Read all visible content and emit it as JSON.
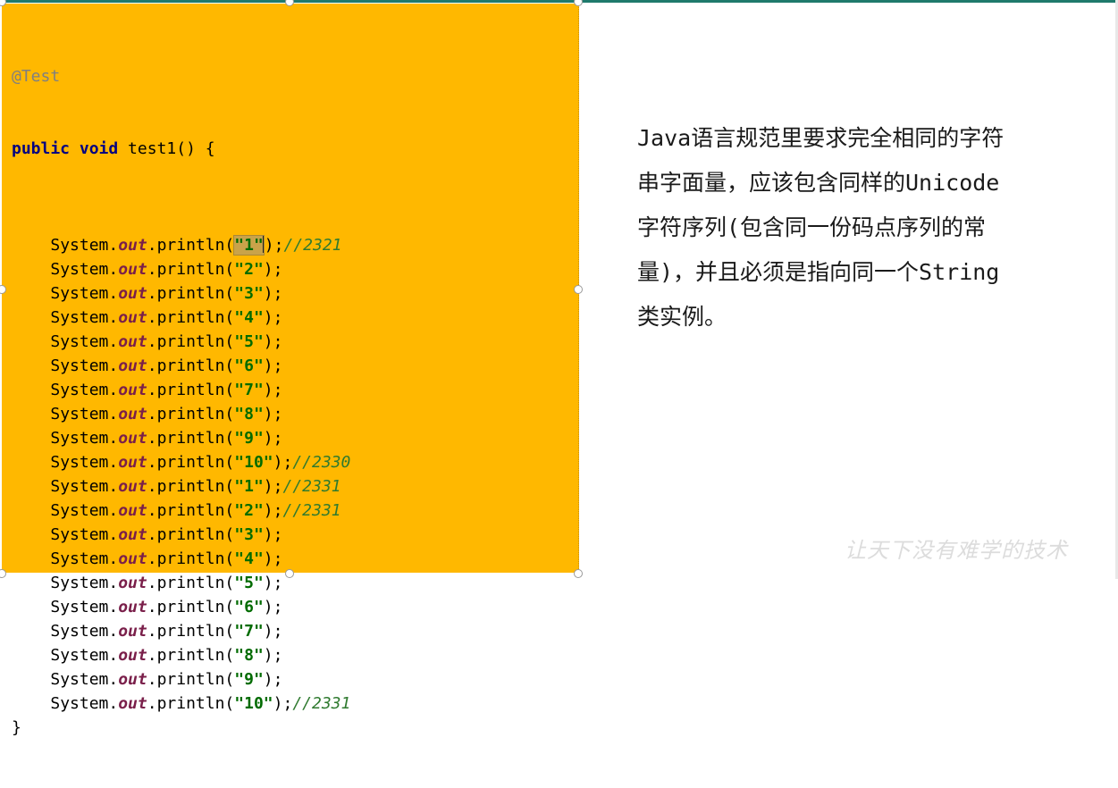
{
  "code": {
    "annotation": "@Test",
    "signature_kw": "public void",
    "signature_rest": " test1() {",
    "indent": "    ",
    "receiver": "System.",
    "field": "out",
    "method": ".println(",
    "close": ");",
    "end_brace": "}",
    "statements": [
      {
        "arg": "\"1\"",
        "comment": "//2321"
      },
      {
        "arg": "\"2\"",
        "comment": ""
      },
      {
        "arg": "\"3\"",
        "comment": ""
      },
      {
        "arg": "\"4\"",
        "comment": ""
      },
      {
        "arg": "\"5\"",
        "comment": ""
      },
      {
        "arg": "\"6\"",
        "comment": ""
      },
      {
        "arg": "\"7\"",
        "comment": ""
      },
      {
        "arg": "\"8\"",
        "comment": ""
      },
      {
        "arg": "\"9\"",
        "comment": ""
      },
      {
        "arg": "\"10\"",
        "comment": "//2330"
      },
      {
        "arg": "\"1\"",
        "comment": "//2331"
      },
      {
        "arg": "\"2\"",
        "comment": "//2331"
      },
      {
        "arg": "\"3\"",
        "comment": ""
      },
      {
        "arg": "\"4\"",
        "comment": ""
      },
      {
        "arg": "\"5\"",
        "comment": ""
      },
      {
        "arg": "\"6\"",
        "comment": ""
      },
      {
        "arg": "\"7\"",
        "comment": ""
      },
      {
        "arg": "\"8\"",
        "comment": ""
      },
      {
        "arg": "\"9\"",
        "comment": ""
      },
      {
        "arg": "\"10\"",
        "comment": "//2331"
      }
    ]
  },
  "description": {
    "lines": [
      "Java语言规范里要求完全相同的字符",
      "串字面量，应该包含同样的Unicode",
      "字符序列(包含同一份码点序列的常",
      "量)，并且必须是指向同一个String",
      "类实例。"
    ]
  },
  "watermark": "让天下没有难学的技术",
  "colors": {
    "code_background": "#ffb800",
    "keyword": "#000080",
    "field": "#7a1f4a",
    "string": "#006b00",
    "comment": "#2f7a2f",
    "annotation": "#808080",
    "top_line": "#1f7a6c"
  }
}
